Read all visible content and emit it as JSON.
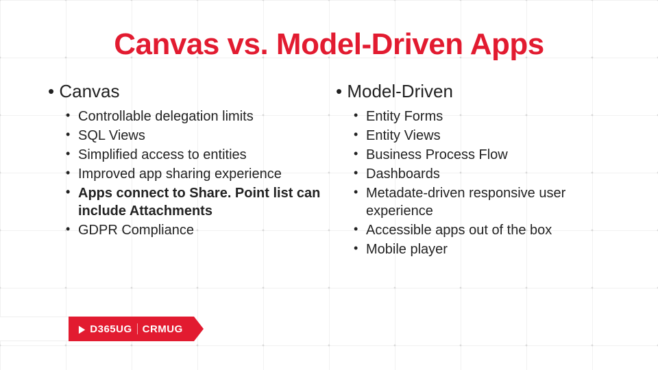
{
  "title": "Canvas vs. Model-Driven Apps",
  "colors": {
    "accent": "#e21b30"
  },
  "columns": {
    "left": {
      "heading": "Canvas",
      "items": [
        {
          "text": "Controllable delegation limits",
          "bold": false
        },
        {
          "text": "SQL Views",
          "bold": false
        },
        {
          "text": "Simplified access to entities",
          "bold": false
        },
        {
          "text": "Improved app sharing experience",
          "bold": false
        },
        {
          "text": "Apps connect to Share. Point list can include Attachments",
          "bold": true
        },
        {
          "text": "GDPR Compliance",
          "bold": false
        }
      ]
    },
    "right": {
      "heading": "Model-Driven",
      "items": [
        {
          "text": "Entity Forms",
          "bold": false
        },
        {
          "text": "Entity Views",
          "bold": false
        },
        {
          "text": "Business Process Flow",
          "bold": false
        },
        {
          "text": "Dashboards",
          "bold": false
        },
        {
          "text": "Metadate-driven responsive user experience",
          "bold": false
        },
        {
          "text": "Accessible apps out of the box",
          "bold": false
        },
        {
          "text": "Mobile player",
          "bold": false
        }
      ]
    }
  },
  "footer_badge": {
    "left": "D365UG",
    "right": "CRMUG"
  }
}
